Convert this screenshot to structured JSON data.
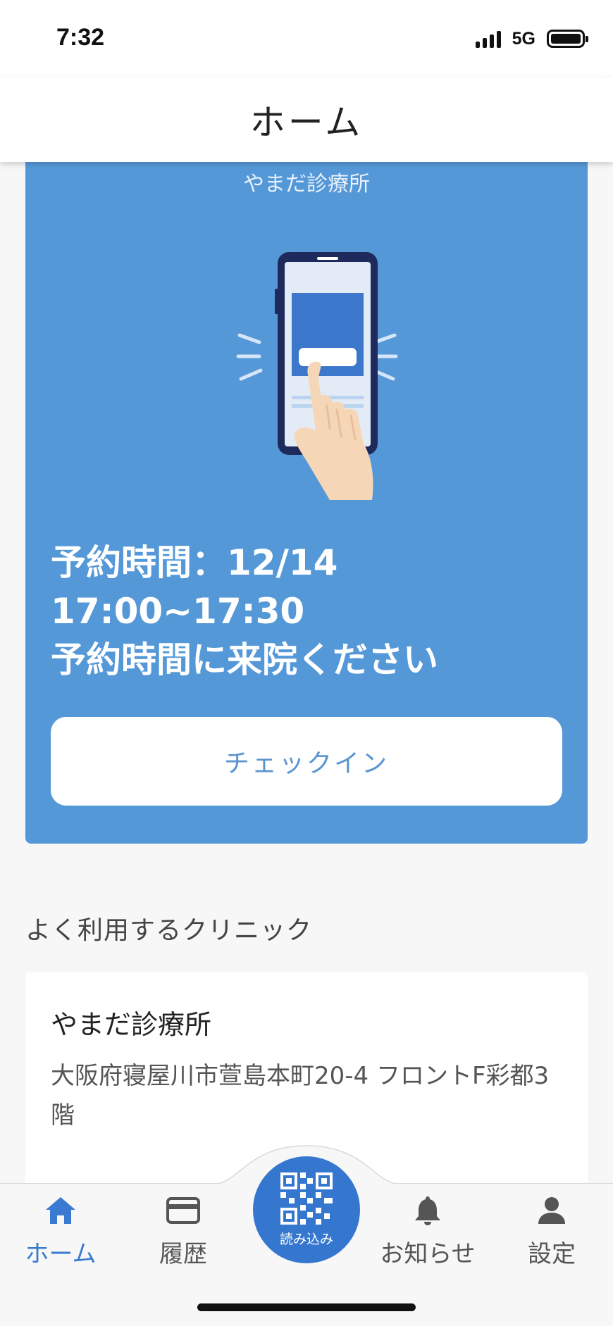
{
  "status": {
    "time": "7:32",
    "network": "5G"
  },
  "header": {
    "title": "ホーム"
  },
  "hero": {
    "clinic_name": "やまだ診療所",
    "line1": "予約時間：12/14",
    "line2": "17:00~17:30",
    "line3": "予約時間に来院ください",
    "checkin_label": "チェックイン"
  },
  "frequent": {
    "section_title": "よく利用するクリニック",
    "clinic_name": "やまだ診療所",
    "clinic_address": "大阪府寝屋川市萱島本町20-4 フロントF彩都3階"
  },
  "nav": {
    "items": [
      {
        "label": "ホーム",
        "icon": "home-icon",
        "active": true
      },
      {
        "label": "履歴",
        "icon": "card-icon",
        "active": false
      },
      {
        "label": "お知らせ",
        "icon": "bell-icon",
        "active": false
      },
      {
        "label": "設定",
        "icon": "person-icon",
        "active": false
      }
    ],
    "scan_label": "読み込み",
    "scan_icon": "qr-code-icon"
  },
  "colors": {
    "accent": "#3577cf",
    "hero_bg": "#5598d8",
    "checkin_text": "#5b95cf"
  }
}
